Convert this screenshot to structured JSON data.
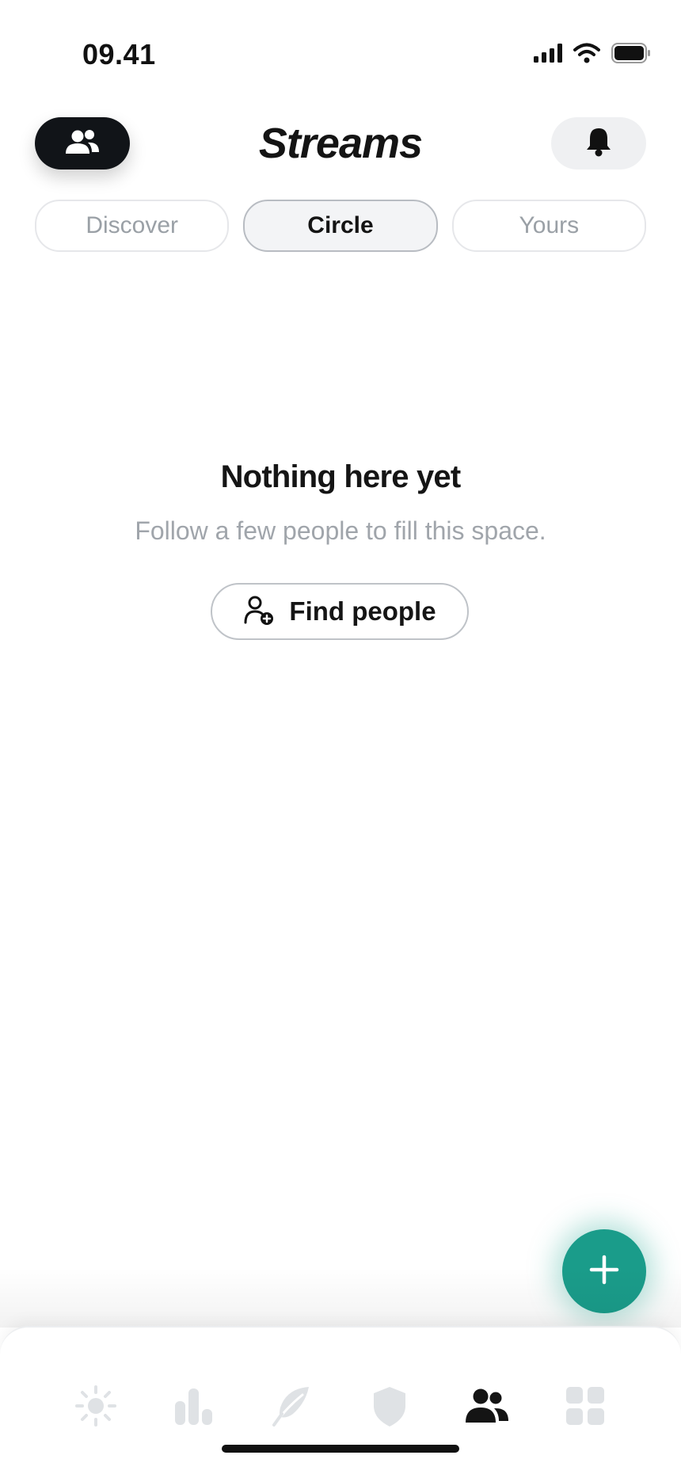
{
  "status_bar": {
    "time": "09.41",
    "icons": [
      "cellular-signal-icon",
      "wifi-icon",
      "battery-icon"
    ]
  },
  "header": {
    "title": "Streams",
    "left_button_icon": "people-icon",
    "right_button_icon": "bell-icon"
  },
  "tabs": [
    {
      "label": "Discover",
      "active": false
    },
    {
      "label": "Circle",
      "active": true
    },
    {
      "label": "Yours",
      "active": false
    }
  ],
  "empty_state": {
    "title": "Nothing here yet",
    "subtitle": "Follow a few people to fill this space.",
    "button_label": "Find people",
    "button_icon": "add-person-icon"
  },
  "fab": {
    "icon": "plus-icon",
    "color": "#1a9c8a"
  },
  "bottom_nav": {
    "items": [
      {
        "icon": "sun-icon",
        "active": false
      },
      {
        "icon": "bar-chart-icon",
        "active": false
      },
      {
        "icon": "feather-icon",
        "active": false
      },
      {
        "icon": "shield-icon",
        "active": false
      },
      {
        "icon": "people-icon",
        "active": true
      },
      {
        "icon": "grid-icon",
        "active": false
      }
    ],
    "inactive_color": "#dfe2e5",
    "active_color": "#141414"
  }
}
